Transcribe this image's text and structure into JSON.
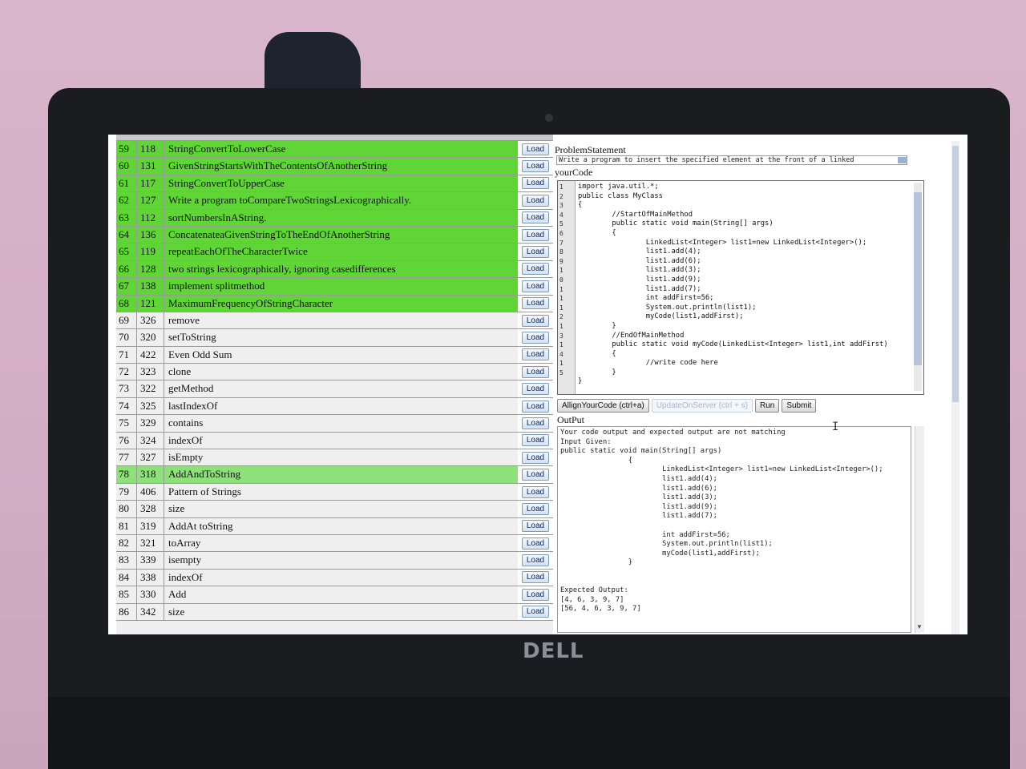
{
  "problems": [
    {
      "num": "59",
      "id": "118",
      "title": "StringConvertToLowerCase",
      "status": "done"
    },
    {
      "num": "60",
      "id": "131",
      "title": "GivenStringStartsWithTheContentsOfAnotherString",
      "status": "done"
    },
    {
      "num": "61",
      "id": "117",
      "title": "StringConvertToUpperCase",
      "status": "done"
    },
    {
      "num": "62",
      "id": "127",
      "title": "Write a program toCompareTwoStringsLexicographically.",
      "status": "done"
    },
    {
      "num": "63",
      "id": "112",
      "title": "sortNumbersInAString.",
      "status": "done"
    },
    {
      "num": "64",
      "id": "136",
      "title": "ConcatenateaGivenStringToTheEndOfAnotherString",
      "status": "done"
    },
    {
      "num": "65",
      "id": "119",
      "title": "repeatEachOfTheCharacterTwice",
      "status": "done"
    },
    {
      "num": "66",
      "id": "128",
      "title": "two strings lexicographically, ignoring casedifferences",
      "status": "done"
    },
    {
      "num": "67",
      "id": "138",
      "title": "implement splitmethod",
      "status": "done"
    },
    {
      "num": "68",
      "id": "121",
      "title": "MaximumFrequencyOfStringCharacter",
      "status": "done"
    },
    {
      "num": "69",
      "id": "326",
      "title": "remove",
      "status": "none"
    },
    {
      "num": "70",
      "id": "320",
      "title": "setToString",
      "status": "none"
    },
    {
      "num": "71",
      "id": "422",
      "title": "Even Odd Sum",
      "status": "none"
    },
    {
      "num": "72",
      "id": "323",
      "title": "clone",
      "status": "none"
    },
    {
      "num": "73",
      "id": "322",
      "title": "getMethod",
      "status": "none"
    },
    {
      "num": "74",
      "id": "325",
      "title": "lastIndexOf",
      "status": "none"
    },
    {
      "num": "75",
      "id": "329",
      "title": "contains",
      "status": "none"
    },
    {
      "num": "76",
      "id": "324",
      "title": "indexOf",
      "status": "none"
    },
    {
      "num": "77",
      "id": "327",
      "title": "isEmpty",
      "status": "none"
    },
    {
      "num": "78",
      "id": "318",
      "title": "AddAndToString",
      "status": "light"
    },
    {
      "num": "79",
      "id": "406",
      "title": "Pattern of Strings",
      "status": "none"
    },
    {
      "num": "80",
      "id": "328",
      "title": "size",
      "status": "none"
    },
    {
      "num": "81",
      "id": "319",
      "title": "AddAt toString",
      "status": "none"
    },
    {
      "num": "82",
      "id": "321",
      "title": "toArray",
      "status": "none"
    },
    {
      "num": "83",
      "id": "339",
      "title": "isempty",
      "status": "none"
    },
    {
      "num": "84",
      "id": "338",
      "title": "indexOf",
      "status": "none"
    },
    {
      "num": "85",
      "id": "330",
      "title": "Add",
      "status": "none"
    },
    {
      "num": "86",
      "id": "342",
      "title": "size",
      "status": "none"
    }
  ],
  "load_label": "Load",
  "problem_statement": {
    "label": "ProblemStatement",
    "text": "Write a program to insert the specified element at the front of a linked"
  },
  "your_code": {
    "label": "yourCode",
    "gutter": [
      "1",
      "2",
      "3",
      "4",
      "5",
      "6",
      "7",
      "8",
      "9",
      "1",
      "0",
      "1",
      "1",
      "1",
      "2",
      "1",
      "3",
      "1",
      "4",
      "1",
      "5"
    ],
    "code": "import java.util.*;\npublic class MyClass\n{\n        //StartOfMainMethod\n        public static void main(String[] args)\n        {\n                LinkedList<Integer> list1=new LinkedList<Integer>();\n                list1.add(4);\n                list1.add(6);\n                list1.add(3);\n                list1.add(9);\n                list1.add(7);\n                int addFirst=56;\n                System.out.println(list1);\n                myCode(list1,addFirst);\n        }\n        //EndOfMainMethod\n        public static void myCode(LinkedList<Integer> list1,int addFirst)\n        {\n                //write code here\n        }\n}"
  },
  "toolbar": {
    "align_label": "AllignYourCode (ctrl+a)",
    "update_label": "UpdateOnServer (ctrl + s)",
    "run_label": "Run",
    "submit_label": "Submit"
  },
  "output": {
    "label": "OutPut",
    "text": "Your code output and expected output are not matching\nInput Given:\npublic static void main(String[] args)\n                {\n                        LinkedList<Integer> list1=new LinkedList<Integer>();\n                        list1.add(4);\n                        list1.add(6);\n                        list1.add(3);\n                        list1.add(9);\n                        list1.add(7);\n\n                        int addFirst=56;\n                        System.out.println(list1);\n                        myCode(list1,addFirst);\n                }\n\n\nExpected Output:\n[4, 6, 3, 9, 7]\n[56, 4, 6, 3, 9, 7]"
  },
  "brand": "DELL",
  "colors": {
    "solved": "#5fd636",
    "partial": "#8ee07a"
  }
}
